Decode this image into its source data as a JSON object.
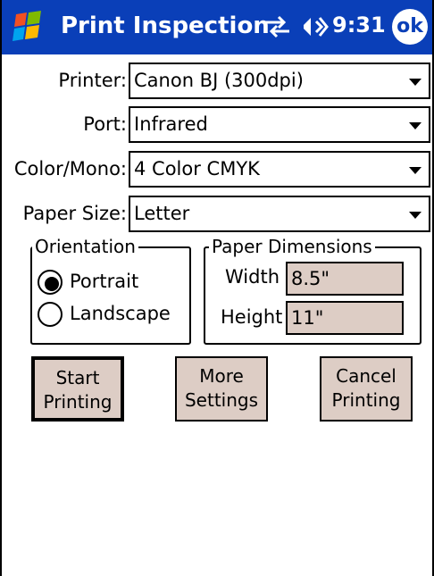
{
  "titlebar": {
    "title": "Print Inspection",
    "time": "9:31",
    "ok_label": "ok",
    "icons": [
      "windows-start-icon",
      "connectivity-icon",
      "volume-icon"
    ]
  },
  "form": {
    "printer": {
      "label": "Printer:",
      "value": "Canon BJ (300dpi)"
    },
    "port": {
      "label": "Port:",
      "value": "Infrared"
    },
    "color": {
      "label": "Color/Mono:",
      "value": "4 Color CMYK"
    },
    "paper_size": {
      "label": "Paper Size:",
      "value": "Letter"
    }
  },
  "orientation": {
    "title": "Orientation",
    "portrait_label": "Portrait",
    "landscape_label": "Landscape",
    "selected": "Portrait"
  },
  "dimensions": {
    "title": "Paper Dimensions",
    "width_label": "Width",
    "width_value": "8.5\"",
    "height_label": "Height",
    "height_value": "11\""
  },
  "buttons": {
    "start": {
      "line1": "Start",
      "line2": "Printing"
    },
    "more": {
      "line1": "More",
      "line2": "Settings"
    },
    "cancel": {
      "line1": "Cancel",
      "line2": "Printing"
    }
  },
  "colors": {
    "titlebar": "#0a3fb8",
    "control_fill": "#ddcdc5"
  }
}
